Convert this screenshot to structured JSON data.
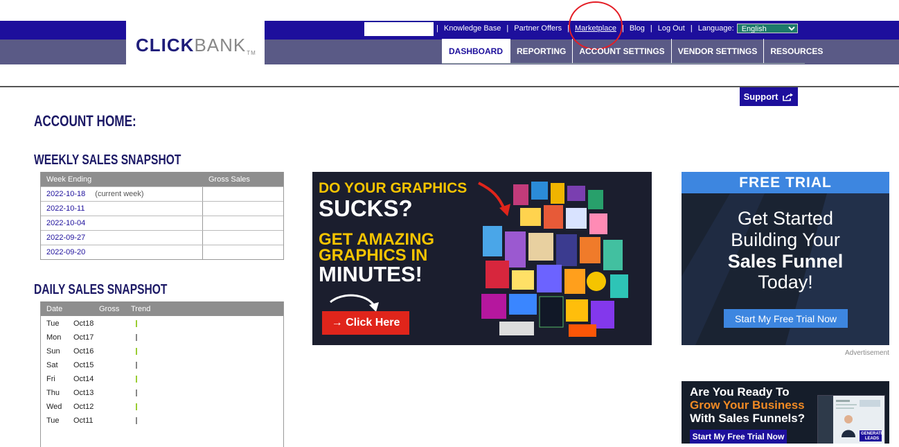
{
  "logo": {
    "click": "CLICK",
    "bank": "BANK",
    "tm": "TM"
  },
  "top_links": {
    "knowledge_base": "Knowledge Base",
    "partner_offers": "Partner Offers",
    "marketplace": "Marketplace",
    "blog": "Blog",
    "log_out": "Log Out",
    "language_label": "Language:",
    "language_value": "English"
  },
  "nav_tabs": [
    "DASHBOARD",
    "REPORTING",
    "ACCOUNT SETTINGS",
    "VENDOR SETTINGS",
    "RESOURCES"
  ],
  "support_label": "Support",
  "account_home": "ACCOUNT HOME:",
  "weekly": {
    "title": "WEEKLY SALES SNAPSHOT",
    "headers": [
      "Week Ending",
      "Gross Sales"
    ],
    "rows": [
      {
        "date": "2022-10-18",
        "note": "(current week)"
      },
      {
        "date": "2022-10-11",
        "note": ""
      },
      {
        "date": "2022-10-04",
        "note": ""
      },
      {
        "date": "2022-09-27",
        "note": ""
      },
      {
        "date": "2022-09-20",
        "note": ""
      }
    ]
  },
  "daily": {
    "title": "DAILY SALES SNAPSHOT",
    "headers": [
      "Date",
      "Gross",
      "Trend"
    ],
    "rows": [
      {
        "day": "Tue",
        "date": "Oct18"
      },
      {
        "day": "Mon",
        "date": "Oct17"
      },
      {
        "day": "Sun",
        "date": "Oct16"
      },
      {
        "day": "Sat",
        "date": "Oct15"
      },
      {
        "day": "Fri",
        "date": "Oct14"
      },
      {
        "day": "Thu",
        "date": "Oct13"
      },
      {
        "day": "Wed",
        "date": "Oct12"
      },
      {
        "day": "Tue",
        "date": "Oct11"
      }
    ]
  },
  "ad1": {
    "line1": "DO YOUR GRAPHICS",
    "line2": "SUCKS?",
    "line3": "GET AMAZING",
    "line4": "GRAPHICS IN",
    "line5": "MINUTES!",
    "button": "→ Click Here"
  },
  "ad2": {
    "header": "FREE TRIAL",
    "line1": "Get Started",
    "line2": "Building Your",
    "line3": "Sales Funnel",
    "line4": "Today!",
    "button": "Start My Free Trial Now"
  },
  "ad_label": "Advertisement",
  "ad3": {
    "line1": "Are You Ready To",
    "line2": "Grow Your Business",
    "line3": "With Sales Funnels?",
    "button": "Start My Free Trial Now",
    "thumb_text": "GENERATE LEADS"
  },
  "colors": {
    "brand_navy": "#1d0f9c",
    "nav_grey": "#5a5a86",
    "accent_blue": "#3d86e0",
    "ad_yellow": "#f5c400",
    "ad_red": "#e0251b",
    "annotation_red": "#e41e26"
  }
}
